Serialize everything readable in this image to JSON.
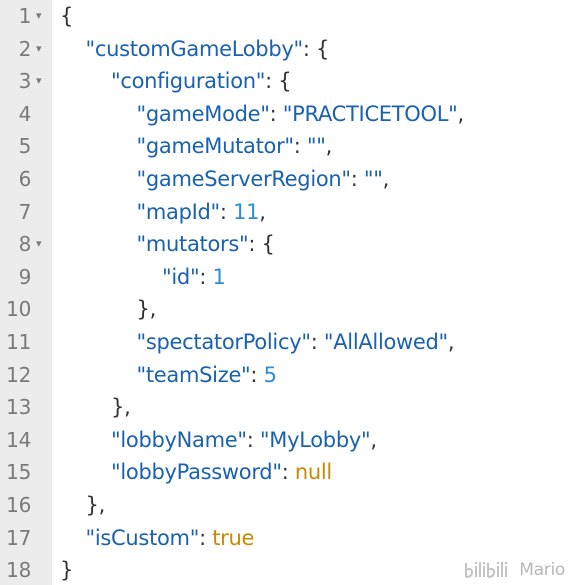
{
  "editor": {
    "line_numbers": [
      "1",
      "2",
      "3",
      "4",
      "5",
      "6",
      "7",
      "8",
      "9",
      "10",
      "11",
      "12",
      "13",
      "14",
      "15",
      "16",
      "17",
      "18"
    ],
    "fold_markers": {
      "1": "▾",
      "2": "▾",
      "3": "▾",
      "8": "▾"
    },
    "lines": [
      [
        {
          "t": "punc",
          "v": "{"
        }
      ],
      [
        {
          "t": "indent",
          "v": "    "
        },
        {
          "t": "key",
          "v": "\"customGameLobby\""
        },
        {
          "t": "punc",
          "v": ": {"
        }
      ],
      [
        {
          "t": "indent",
          "v": "        "
        },
        {
          "t": "key",
          "v": "\"configuration\""
        },
        {
          "t": "punc",
          "v": ": {"
        }
      ],
      [
        {
          "t": "indent",
          "v": "            "
        },
        {
          "t": "key",
          "v": "\"gameMode\""
        },
        {
          "t": "punc",
          "v": ": "
        },
        {
          "t": "str",
          "v": "\"PRACTICETOOL\""
        },
        {
          "t": "punc",
          "v": ","
        }
      ],
      [
        {
          "t": "indent",
          "v": "            "
        },
        {
          "t": "key",
          "v": "\"gameMutator\""
        },
        {
          "t": "punc",
          "v": ": "
        },
        {
          "t": "str",
          "v": "\"\""
        },
        {
          "t": "punc",
          "v": ","
        }
      ],
      [
        {
          "t": "indent",
          "v": "            "
        },
        {
          "t": "key",
          "v": "\"gameServerRegion\""
        },
        {
          "t": "punc",
          "v": ": "
        },
        {
          "t": "str",
          "v": "\"\""
        },
        {
          "t": "punc",
          "v": ","
        }
      ],
      [
        {
          "t": "indent",
          "v": "            "
        },
        {
          "t": "key",
          "v": "\"mapId\""
        },
        {
          "t": "punc",
          "v": ": "
        },
        {
          "t": "num",
          "v": "11"
        },
        {
          "t": "punc",
          "v": ","
        }
      ],
      [
        {
          "t": "indent",
          "v": "            "
        },
        {
          "t": "key",
          "v": "\"mutators\""
        },
        {
          "t": "punc",
          "v": ": {"
        }
      ],
      [
        {
          "t": "indent",
          "v": "                "
        },
        {
          "t": "key",
          "v": "\"id\""
        },
        {
          "t": "punc",
          "v": ": "
        },
        {
          "t": "num",
          "v": "1"
        }
      ],
      [
        {
          "t": "indent",
          "v": "            "
        },
        {
          "t": "punc",
          "v": "},"
        }
      ],
      [
        {
          "t": "indent",
          "v": "            "
        },
        {
          "t": "key",
          "v": "\"spectatorPolicy\""
        },
        {
          "t": "punc",
          "v": ": "
        },
        {
          "t": "str",
          "v": "\"AllAllowed\""
        },
        {
          "t": "punc",
          "v": ","
        }
      ],
      [
        {
          "t": "indent",
          "v": "            "
        },
        {
          "t": "key",
          "v": "\"teamSize\""
        },
        {
          "t": "punc",
          "v": ": "
        },
        {
          "t": "num",
          "v": "5"
        }
      ],
      [
        {
          "t": "indent",
          "v": "        "
        },
        {
          "t": "punc",
          "v": "},"
        }
      ],
      [
        {
          "t": "indent",
          "v": "        "
        },
        {
          "t": "key",
          "v": "\"lobbyName\""
        },
        {
          "t": "punc",
          "v": ": "
        },
        {
          "t": "str",
          "v": "\"MyLobby\""
        },
        {
          "t": "punc",
          "v": ","
        }
      ],
      [
        {
          "t": "indent",
          "v": "        "
        },
        {
          "t": "key",
          "v": "\"lobbyPassword\""
        },
        {
          "t": "punc",
          "v": ": "
        },
        {
          "t": "kw",
          "v": "null"
        }
      ],
      [
        {
          "t": "indent",
          "v": "    "
        },
        {
          "t": "punc",
          "v": "},"
        }
      ],
      [
        {
          "t": "indent",
          "v": "    "
        },
        {
          "t": "key",
          "v": "\"isCustom\""
        },
        {
          "t": "punc",
          "v": ": "
        },
        {
          "t": "kw",
          "v": "true"
        }
      ],
      [
        {
          "t": "punc",
          "v": "}"
        }
      ]
    ]
  },
  "watermark": {
    "logo_icon": "bilibili-logo-icon",
    "text": "Mario"
  },
  "colors": {
    "key": "#1a62b0",
    "string": "#1a62b0",
    "number": "#2f8fd6",
    "keyword": "#c88a00",
    "punctuation": "#333333",
    "gutter_bg": "#ececec",
    "line_number": "#7a7a7a"
  }
}
